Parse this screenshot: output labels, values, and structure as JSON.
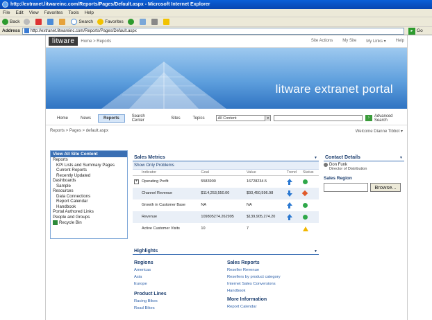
{
  "window": {
    "title": "http://extranet.litwareinc.com/Reports/Pages/Default.aspx - Microsoft Internet Explorer"
  },
  "menu": [
    "File",
    "Edit",
    "View",
    "Favorites",
    "Tools",
    "Help"
  ],
  "toolbar": {
    "back": "Back",
    "search": "Search",
    "favorites": "Favorites"
  },
  "address": {
    "label": "Address",
    "url": "http://extranet.litwareinc.com/Reports/Pages/Default.aspx",
    "go": "Go"
  },
  "site": {
    "logo": "litware",
    "breadcrumb_top": "Home > Reports",
    "top_links": [
      "Site Actions",
      "My Site",
      "My Links ▾",
      "Help"
    ],
    "banner_title": "litware extranet portal"
  },
  "tabs": [
    "Home",
    "News",
    "Reports",
    "Search Center",
    "Sites",
    "Topics"
  ],
  "search": {
    "scope": "All Content",
    "go": "›",
    "advanced": "Advanced Search"
  },
  "subbar": {
    "breadcrumb": "Reports > Pages > default.aspx",
    "welcome": "Welcome Dianne Tibbot ▾"
  },
  "leftnav": {
    "header": "View All Site Content",
    "items": [
      {
        "label": "Reports",
        "sub": false
      },
      {
        "label": "KPI Lists and Summary Pages",
        "sub": true
      },
      {
        "label": "Current Reports",
        "sub": true
      },
      {
        "label": "Recently Updated",
        "sub": true
      },
      {
        "label": "Dashboards",
        "sub": false
      },
      {
        "label": "Sample",
        "sub": true
      },
      {
        "label": "Resources",
        "sub": false
      },
      {
        "label": "Data Connections",
        "sub": true
      },
      {
        "label": "Report Calendar",
        "sub": true
      },
      {
        "label": "Handbook",
        "sub": true
      },
      {
        "label": "Portal Authored Links",
        "sub": false
      },
      {
        "label": "People and Groups",
        "sub": false
      }
    ],
    "recycle": "Recycle Bin"
  },
  "metrics": {
    "title": "Sales Metrics",
    "show_only": "Show Only Problems",
    "columns": [
      "Indicator",
      "Goal",
      "Value",
      "Trend",
      "Status"
    ],
    "rows": [
      {
        "indicator": "Operating Profit",
        "goal": "5583900",
        "value": "16728234.5",
        "trend": "up",
        "status": "green",
        "expand": true
      },
      {
        "indicator": "Channel Revenue",
        "goal": "$114,253,550.00",
        "value": "$93,450,596.98",
        "trend": "down",
        "status": "red",
        "expand": false
      },
      {
        "indicator": "Growth in Customer Base",
        "goal": "NA",
        "value": "NA",
        "trend": "up",
        "status": "green",
        "expand": false
      },
      {
        "indicator": "Revenue",
        "goal": "109805274.262995",
        "value": "$139,905,274.20",
        "trend": "up",
        "status": "green",
        "expand": false
      },
      {
        "indicator": "Active Customer Visits",
        "goal": "10",
        "value": "7",
        "trend": "",
        "status": "yellow",
        "expand": false
      }
    ]
  },
  "highlights": {
    "title": "Highlights",
    "col1": [
      {
        "heading": "Regions",
        "links": [
          "Americas",
          "Asia",
          "Europe"
        ]
      },
      {
        "heading": "Product Lines",
        "links": [
          "Racing Bikes",
          "Road Bikes"
        ]
      }
    ],
    "col2": [
      {
        "heading": "Sales Reports",
        "links": [
          "Reseller Revenue",
          "Resellers by product category",
          "Internet Sales Conversions",
          "Handbook"
        ]
      },
      {
        "heading": "More Information",
        "links": [
          "Report Calendar"
        ]
      }
    ]
  },
  "contact": {
    "title": "Contact Details",
    "name": "Don Funk",
    "role": "Director of Distribution",
    "sales_region_label": "Sales Region",
    "browse": "Browse..."
  },
  "colors": {
    "accent": "#3a6fb4",
    "status_green": "#2fa84a",
    "status_red": "#e05a2a",
    "status_yellow": "#f2b700",
    "trend_blue": "#2a78d1"
  }
}
